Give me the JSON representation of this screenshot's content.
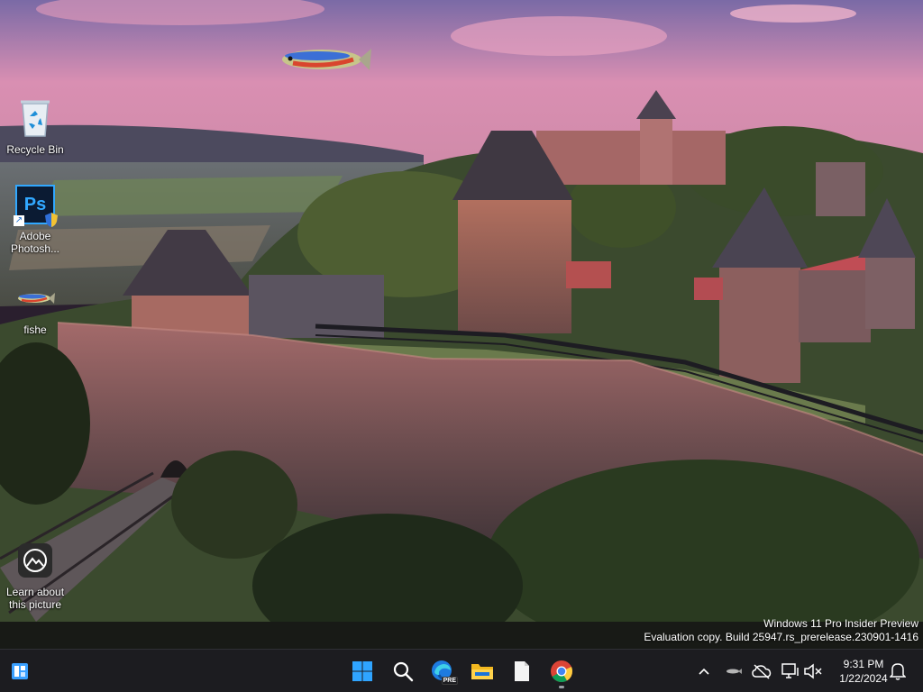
{
  "desktop": {
    "icons": [
      {
        "label": "Recycle Bin",
        "icon": "recycle-bin-icon"
      },
      {
        "label": "Adobe Photosh...",
        "icon": "photoshop-icon"
      },
      {
        "label": "fishe",
        "icon": "fish-file-icon"
      },
      {
        "label": "Learn about this picture",
        "icon": "camera-info-icon"
      }
    ],
    "photoshop_badge": "Ps"
  },
  "watermark": {
    "line1": "Windows 11 Pro Insider Preview",
    "line2": "Evaluation copy. Build 25947.rs_prerelease.230901-1416"
  },
  "taskbar": {
    "pinned": [
      {
        "name": "start",
        "icon": "windows-logo-icon"
      },
      {
        "name": "search",
        "icon": "search-icon"
      },
      {
        "name": "edge-preview",
        "icon": "edge-pre-icon",
        "badge": "PRE"
      },
      {
        "name": "file-explorer",
        "icon": "folder-icon"
      },
      {
        "name": "notepad",
        "icon": "document-icon"
      },
      {
        "name": "chrome",
        "icon": "chrome-icon",
        "running": true
      }
    ],
    "clock": {
      "time": "9:31 PM",
      "date": "1/22/2024"
    }
  },
  "colors": {
    "taskbar_bg": "#1c1c20",
    "accent_blue": "#3aa0ff"
  }
}
